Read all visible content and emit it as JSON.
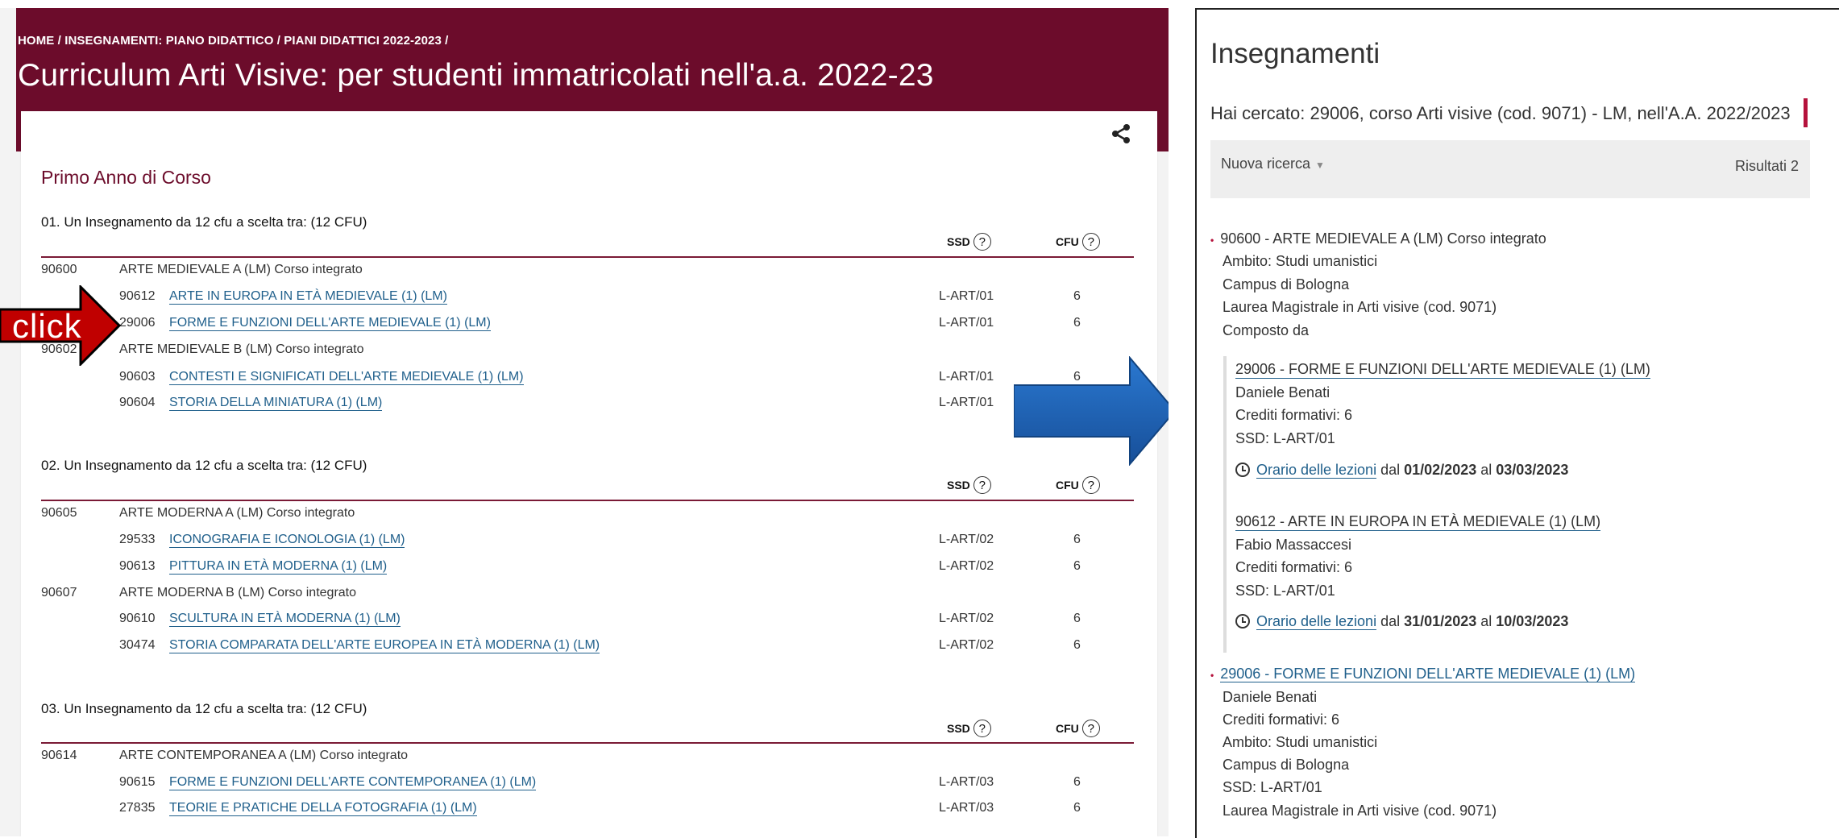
{
  "left": {
    "breadcrumb": "HOME / INSEGNAMENTI: PIANO DIDATTICO / PIANI DIDATTICI 2022-2023 /",
    "title": "Curriculum Arti Visive: per studenti immatricolati nell'a.a. 2022-23",
    "year_heading": "Primo Anno di Corso",
    "col_ssd": "SSD",
    "col_cfu": "CFU",
    "help": "?",
    "groups": [
      {
        "title": "01. Un Insegnamento da 12 cfu a scelta tra: (12 CFU)",
        "rows": [
          {
            "code": "90600",
            "name": "ARTE MEDIEVALE A (LM) Corso integrato"
          },
          {
            "sub": "90612",
            "link": "ARTE IN EUROPA IN ETÀ MEDIEVALE (1) (LM)",
            "ssd": "L-ART/01",
            "cfu": "6"
          },
          {
            "sub": "29006",
            "link": "FORME E FUNZIONI DELL'ARTE MEDIEVALE (1) (LM)",
            "ssd": "L-ART/01",
            "cfu": "6"
          },
          {
            "code": "90602",
            "name": "ARTE MEDIEVALE B (LM) Corso integrato"
          },
          {
            "sub": "90603",
            "link": "CONTESTI E SIGNIFICATI DELL'ARTE MEDIEVALE (1) (LM)",
            "ssd": "L-ART/01",
            "cfu": "6"
          },
          {
            "sub": "90604",
            "link": "STORIA DELLA MINIATURA (1) (LM)",
            "ssd": "L-ART/01",
            "cfu": ""
          }
        ]
      },
      {
        "title": "02. Un Insegnamento da 12 cfu a scelta tra: (12 CFU)",
        "rows": [
          {
            "code": "90605",
            "name": "ARTE MODERNA A (LM) Corso integrato"
          },
          {
            "sub": "29533",
            "link": "ICONOGRAFIA E ICONOLOGIA (1) (LM)",
            "ssd": "L-ART/02",
            "cfu": "6"
          },
          {
            "sub": "90613",
            "link": "PITTURA IN ETÀ MODERNA (1) (LM)",
            "ssd": "L-ART/02",
            "cfu": "6"
          },
          {
            "code": "90607",
            "name": "ARTE MODERNA B (LM) Corso integrato"
          },
          {
            "sub": "90610",
            "link": "SCULTURA IN ETÀ MODERNA (1) (LM)",
            "ssd": "L-ART/02",
            "cfu": "6"
          },
          {
            "sub": "30474",
            "link": "STORIA COMPARATA DELL'ARTE EUROPEA IN ETÀ MODERNA (1) (LM)",
            "ssd": "L-ART/02",
            "cfu": "6"
          }
        ]
      },
      {
        "title": "03. Un Insegnamento da 12 cfu a scelta tra: (12 CFU)",
        "rows": [
          {
            "code": "90614",
            "name": "ARTE CONTEMPORANEA A (LM) Corso integrato"
          },
          {
            "sub": "90615",
            "link": "FORME E FUNZIONI DELL'ARTE CONTEMPORANEA (1) (LM)",
            "ssd": "L-ART/03",
            "cfu": "6"
          },
          {
            "sub": "27835",
            "link": "TEORIE E PRATICHE DELLA FOTOGRAFIA (1) (LM)",
            "ssd": "L-ART/03",
            "cfu": "6"
          }
        ]
      }
    ]
  },
  "annotation": {
    "click_label": "click",
    "accent_red": "#c00000",
    "accent_blue": "#1f63b8"
  },
  "right": {
    "title": "Insegnamenti",
    "search_summary": "Hai cercato: 29006, corso Arti visive (cod. 9071) - LM, nell'A.A. 2022/2023",
    "new_search": "Nuova ricerca",
    "results": "Risultati 2",
    "bullet": "•",
    "r1": {
      "title": "90600 - ARTE MEDIEVALE A (LM) Corso integrato",
      "ambito": "Ambito: Studi umanistici",
      "campus": "Campus di Bologna",
      "laurea": "Laurea Magistrale in Arti visive (cod. 9071)",
      "composto": "Composto da",
      "subs": [
        {
          "link": "29006 - FORME E FUNZIONI DELL'ARTE MEDIEVALE (1) (LM)",
          "teacher": "Daniele Benati",
          "crediti": "Crediti formativi: 6",
          "ssd": "SSD: L-ART/01",
          "orario": "Orario delle lezioni",
          "dal": "dal",
          "from": "01/02/2023",
          "al": "al",
          "to": "03/03/2023"
        },
        {
          "link": "90612 - ARTE IN EUROPA IN ETÀ MEDIEVALE (1) (LM)",
          "teacher": "Fabio Massaccesi",
          "crediti": "Crediti formativi: 6",
          "ssd": "SSD: L-ART/01",
          "orario": "Orario delle lezioni",
          "dal": "dal",
          "from": "31/01/2023",
          "al": "al",
          "to": "10/03/2023"
        }
      ]
    },
    "r2": {
      "link": "29006 - FORME E FUNZIONI DELL'ARTE MEDIEVALE (1) (LM)",
      "teacher": "Daniele Benati",
      "crediti": "Crediti formativi: 6",
      "ambito": "Ambito: Studi umanistici",
      "campus": "Campus di Bologna",
      "ssd": "SSD: L-ART/01",
      "laurea": "Laurea Magistrale in Arti visive (cod. 9071)"
    }
  }
}
